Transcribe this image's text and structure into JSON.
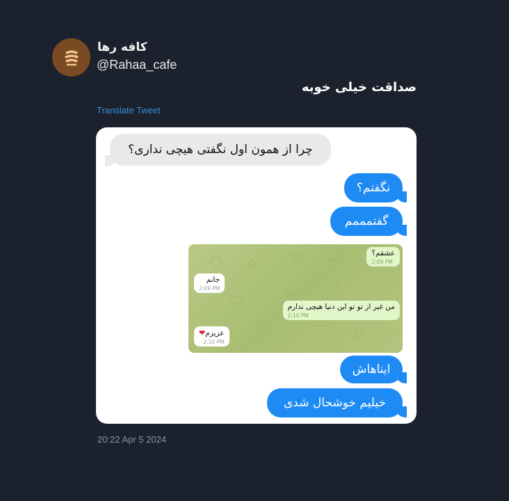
{
  "tweet": {
    "author_name": "کافه رها",
    "handle": "@Rahaa_cafe",
    "text": "صداقت خیلی خوبه",
    "translate_label": "Translate Tweet",
    "timestamp": "20:22  Apr 5 2024"
  },
  "chat": {
    "messages": [
      {
        "text": "چرا از همون اول نگفتی هیچی نداری؟",
        "side": "received"
      },
      {
        "text": "نگفتم؟",
        "side": "sent"
      },
      {
        "text": "گفتمممم",
        "side": "sent"
      },
      {
        "text": "ایناهاش",
        "side": "sent"
      },
      {
        "text": "خیلیم خوشحال شدی",
        "side": "sent"
      }
    ],
    "screenshot_messages": [
      {
        "text": "عشقم؟",
        "time": "2:09 PM",
        "side": "out"
      },
      {
        "text": "جانم",
        "time": "2:09 PM",
        "side": "in"
      },
      {
        "text": "من غیر از تو تو این دنیا هیچی ندارم",
        "time": "2:10 PM",
        "side": "out"
      },
      {
        "text": "عزیزم",
        "time": "2:10 PM",
        "side": "in",
        "emoji": "❤"
      }
    ]
  },
  "colors": {
    "background": "#1b222d",
    "link": "#3b8dd9",
    "sent_bubble": "#1e8bf5",
    "received_bubble": "#e9e9eb"
  },
  "icons": {
    "avatar": "cafe-logo-icon"
  }
}
